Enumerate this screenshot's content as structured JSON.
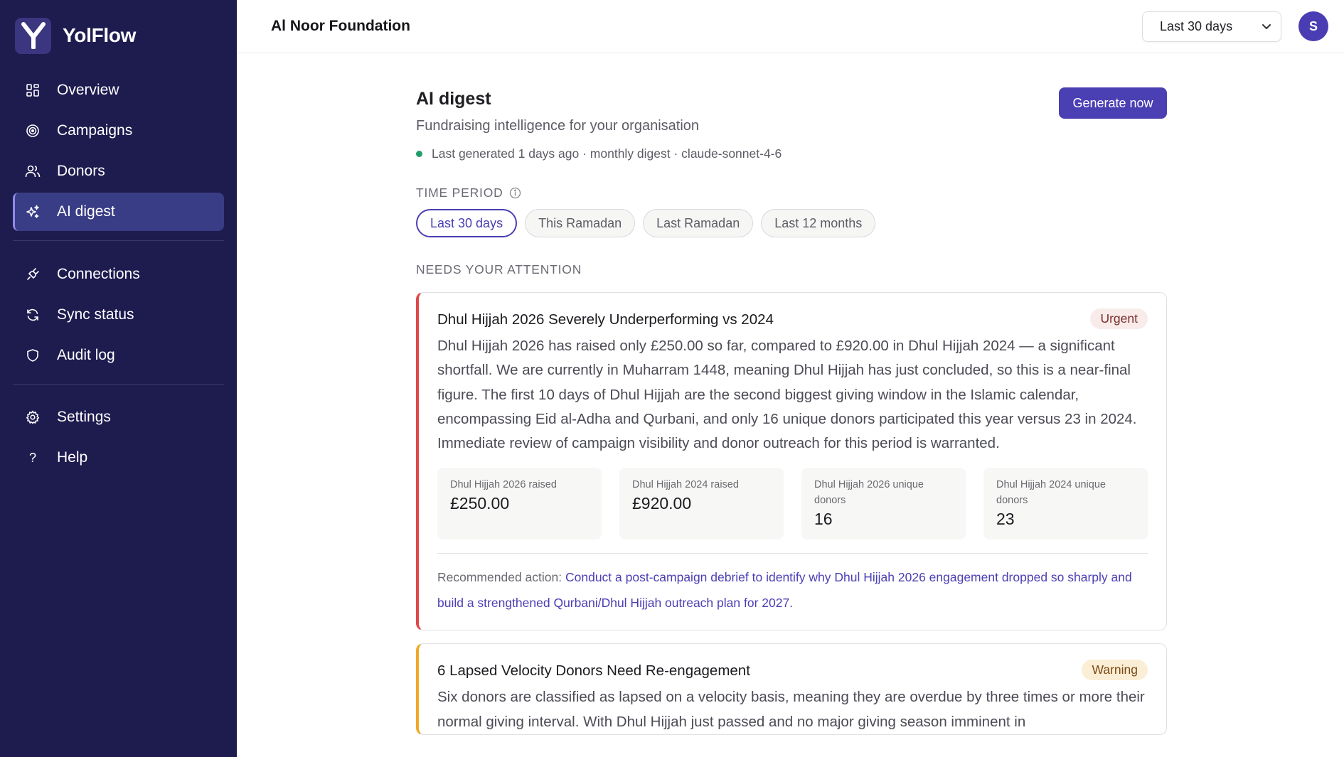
{
  "app": {
    "name": "YolFlow",
    "org_name": "Al Noor Foundation"
  },
  "sidebar": {
    "items": [
      {
        "label": "Overview",
        "icon": "grid-icon",
        "active": false
      },
      {
        "label": "Campaigns",
        "icon": "target-icon",
        "active": false
      },
      {
        "label": "Donors",
        "icon": "users-icon",
        "active": false
      },
      {
        "label": "AI digest",
        "icon": "sparkle-icon",
        "active": true
      },
      {
        "label": "Connections",
        "icon": "plug-icon",
        "active": false
      },
      {
        "label": "Sync status",
        "icon": "refresh-icon",
        "active": false
      },
      {
        "label": "Audit log",
        "icon": "shield-icon",
        "active": false
      },
      {
        "label": "Settings",
        "icon": "gear-icon",
        "active": false
      },
      {
        "label": "Help",
        "icon": "question-icon",
        "active": false
      }
    ]
  },
  "topbar": {
    "range_selected": "Last 30 days",
    "avatar_initial": "S"
  },
  "digest": {
    "title": "AI digest",
    "subtitle": "Fundraising intelligence for your organisation",
    "meta": "Last generated 1 days ago · monthly digest · claude-sonnet-4-6",
    "generate_label": "Generate now",
    "time_period_label": "TIME PERIOD",
    "periods": [
      "Last 30 days",
      "This Ramadan",
      "Last Ramadan",
      "Last 12 months"
    ],
    "active_period": "Last 30 days",
    "attention_label": "NEEDS YOUR ATTENTION"
  },
  "cards": [
    {
      "title": "Dhul Hijjah 2026 Severely Underperforming vs 2024",
      "badge": "Urgent",
      "body": "Dhul Hijjah 2026 has raised only £250.00 so far, compared to £920.00 in Dhul Hijjah 2024 — a significant shortfall. We are currently in Muharram 1448, meaning Dhul Hijjah has just concluded, so this is a near-final figure. The first 10 days of Dhul Hijjah are the second biggest giving window in the Islamic calendar, encompassing Eid al-Adha and Qurbani, and only 16 unique donors participated this year versus 23 in 2024. Immediate review of campaign visibility and donor outreach for this period is warranted.",
      "metrics": [
        {
          "label": "Dhul Hijjah 2026 raised",
          "value": "£250.00"
        },
        {
          "label": "Dhul Hijjah 2024 raised",
          "value": "£920.00"
        },
        {
          "label": "Dhul Hijjah 2026 unique donors",
          "value": "16"
        },
        {
          "label": "Dhul Hijjah 2024 unique donors",
          "value": "23"
        }
      ],
      "recommended_label": "Recommended action:",
      "recommended_text": "Conduct a post-campaign debrief to identify why Dhul Hijjah 2026 engagement dropped so sharply and build a strengthened Qurbani/Dhul Hijjah outreach plan for 2027."
    },
    {
      "title": "6 Lapsed Velocity Donors Need Re-engagement",
      "badge": "Warning",
      "body": "Six donors are classified as lapsed on a velocity basis, meaning they are overdue by three times or more their normal giving interval. With Dhul Hijjah just passed and no major giving season imminent in"
    }
  ],
  "colors": {
    "sidebar_bg": "#1e1b4f",
    "accent": "#4b3fb4",
    "urgent": "#e04848",
    "warning": "#f0a828",
    "status_ok": "#1f9d6b"
  }
}
